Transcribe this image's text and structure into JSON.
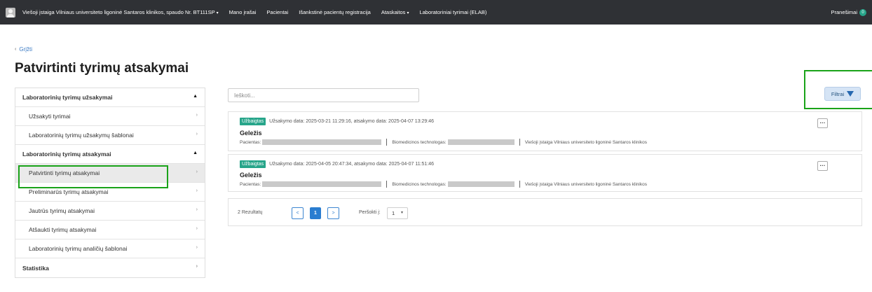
{
  "navbar": {
    "institution": "Viešoji įstaiga Vilniaus universiteto ligoninė Santaros klinikos, spaudo Nr. BT111SP",
    "menu": [
      "Mano įrašai",
      "Pacientai",
      "Išankstinė pacientų registracija",
      "Ataskaitos",
      "Laboratoriniai tyrimai (ELAB)"
    ],
    "notifications_label": "Pranešimai",
    "notifications_count": "0",
    "caret": "▾"
  },
  "back_label": "Grįžti",
  "page_title": "Patvirtinti tyrimų atsakymai",
  "sidebar": {
    "section1_title": "Laboratorinių tyrimų užsakymai",
    "section1_items": [
      "Užsakyti tyrimai",
      "Laboratorinių tyrimų užsakymų šablonai"
    ],
    "section2_title": "Laboratorinių tyrimų atsakymai",
    "section2_items": [
      "Patvirtinti tyrimų atsakymai",
      "Preliminarūs tyrimų atsakymai",
      "Jautrūs tyrimų atsakymai",
      "Atšaukti tyrimų atsakymai",
      "Laboratorinių tyrimų analičių šablonai"
    ],
    "section3_title": "Statistika"
  },
  "search": {
    "placeholder": "Ieškoti..."
  },
  "filter_label": "Filtrai",
  "results": [
    {
      "status": "Užbaigtas",
      "meta": "Užsakymo data: 2025-03-21 11:29:16, atsakymo data: 2025-04-07 13:29:46",
      "name": "Geležis",
      "patient_label": "Pacientas:",
      "technologist_label": "Biomedicinos technologas:",
      "institution": "Viešoji įstaiga Vilniaus universiteto ligoninė Santaros klinikos"
    },
    {
      "status": "Užbaigtas",
      "meta": "Užsakymo data: 2025-04-05 20:47:34, atsakymo data: 2025-04-07 11:51:46",
      "name": "Geležis",
      "patient_label": "Pacientas:",
      "technologist_label": "Biomedicinos technologas:",
      "institution": "Viešoji įstaiga Vilniaus universiteto ligoninė Santaros klinikos"
    }
  ],
  "more_label": "···",
  "pagination": {
    "results_count": "2 Rezultatų",
    "prev": "<",
    "current_page": "1",
    "next": ">",
    "goto_label": "Peršokti į:",
    "goto_value": "1"
  },
  "icons": {
    "back": "‹",
    "arrow": "›",
    "collapse": "▲",
    "dropdown": "▾",
    "filter": "funnel-icon",
    "user": "user-avatar-icon"
  },
  "colors": {
    "navbar": "#2f3135",
    "status_badge": "#27a58a",
    "highlight": "#1aa319",
    "primary": "#2a7dd0"
  }
}
